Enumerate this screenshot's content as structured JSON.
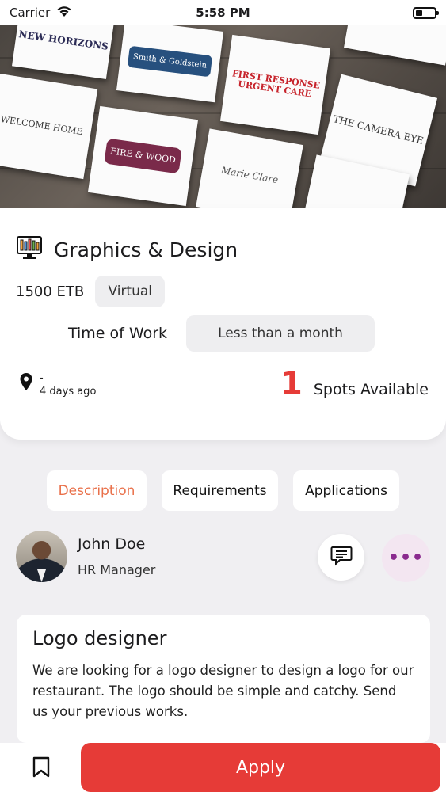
{
  "status_bar": {
    "carrier": "Carrier",
    "time": "5:58 PM"
  },
  "hero": {
    "logos": [
      "NEW HORIZONS",
      "Smith & Goldstein",
      "FIRST RESPONSE URGENT CARE",
      "THE CAMERA EYE",
      "WELCOME HOME",
      "FIRE & WOOD",
      "Marie Clare"
    ]
  },
  "job": {
    "category": "Graphics & Design",
    "price": "1500 ETB",
    "mode": "Virtual",
    "time_of_work_label": "Time of Work",
    "duration": "Less than a month",
    "location": "-",
    "posted": "4 days ago",
    "spots_count": "1",
    "spots_label": "Spots Available"
  },
  "tabs": [
    {
      "label": "Description"
    },
    {
      "label": "Requirements"
    },
    {
      "label": "Applications"
    }
  ],
  "recruiter": {
    "name": "John Doe",
    "role": "HR Manager",
    "more_label": "•••"
  },
  "description": {
    "title": "Logo designer",
    "body": "We are looking for a logo designer to design a logo for our restaurant. The logo should be simple and catchy. Send us your previous works."
  },
  "bottom_bar": {
    "apply_label": "Apply"
  },
  "colors": {
    "accent": "#e63b37",
    "tab_active": "#e9704a",
    "more_button_bg": "#f3e6f1"
  }
}
